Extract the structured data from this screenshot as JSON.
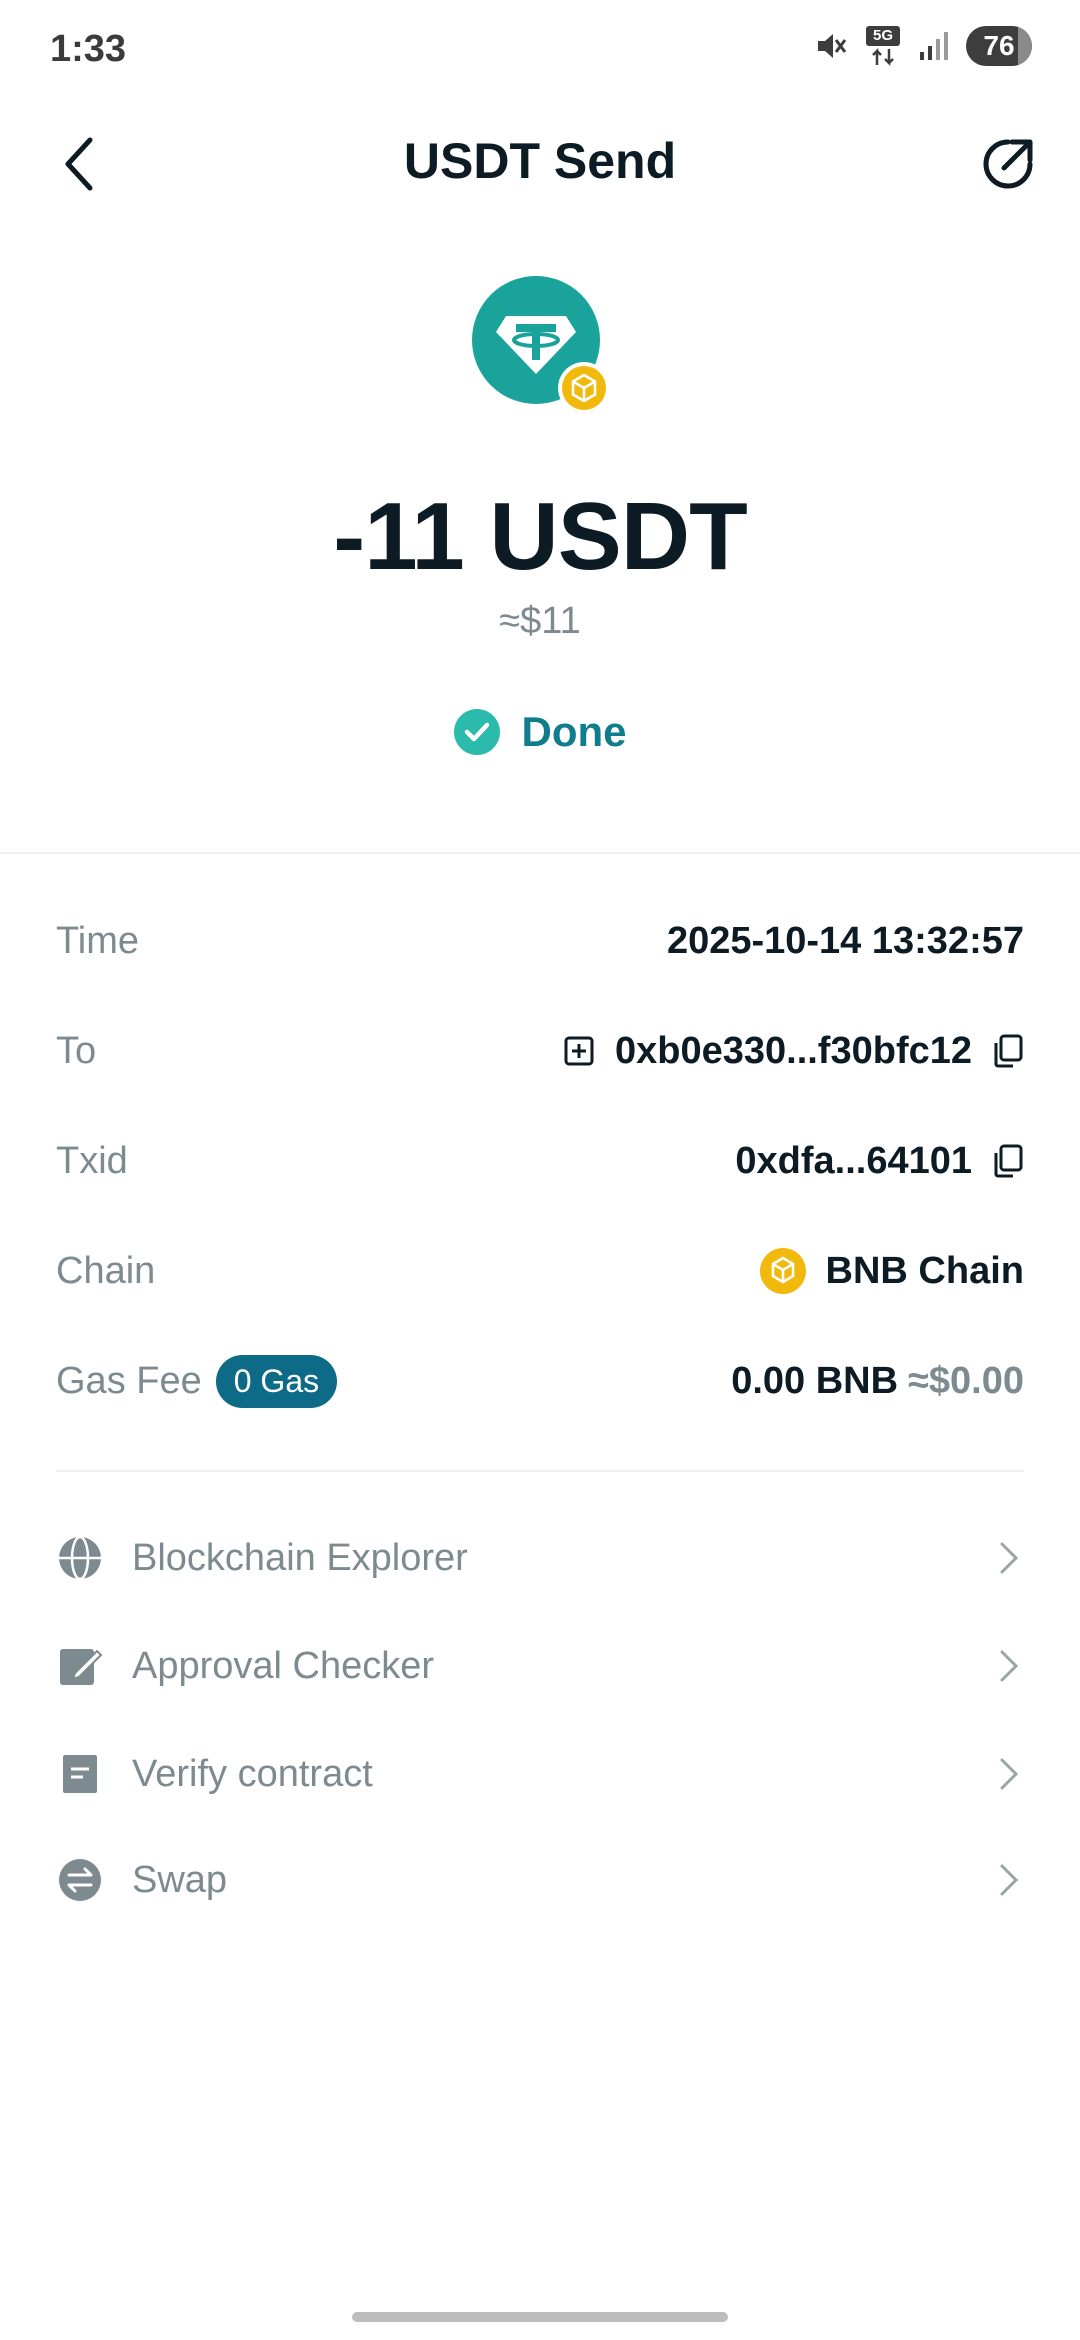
{
  "status_bar": {
    "time": "1:33",
    "network": "5G",
    "battery": "76"
  },
  "header": {
    "title": "USDT Send"
  },
  "transaction": {
    "amount": "-11 USDT",
    "fiat": "≈$11",
    "status": "Done"
  },
  "details": {
    "time_label": "Time",
    "time_value": "2025-10-14 13:32:57",
    "to_label": "To",
    "to_value": "0xb0e330...f30bfc12",
    "txid_label": "Txid",
    "txid_value": "0xdfa...64101",
    "chain_label": "Chain",
    "chain_value": "BNB Chain",
    "gas_label": "Gas Fee",
    "gas_badge": "0 Gas",
    "gas_value": "0.00 BNB",
    "gas_fiat": "≈$0.00"
  },
  "actions": [
    {
      "label": "Blockchain Explorer",
      "icon": "globe-icon"
    },
    {
      "label": "Approval Checker",
      "icon": "approval-icon"
    },
    {
      "label": "Verify contract",
      "icon": "document-icon"
    },
    {
      "label": "Swap",
      "icon": "swap-icon"
    }
  ],
  "colors": {
    "usdt_green": "#1aa39a",
    "bnb_yellow": "#f0b90b",
    "done_teal": "#0f7e8c",
    "gas_badge": "#0d6b87"
  }
}
